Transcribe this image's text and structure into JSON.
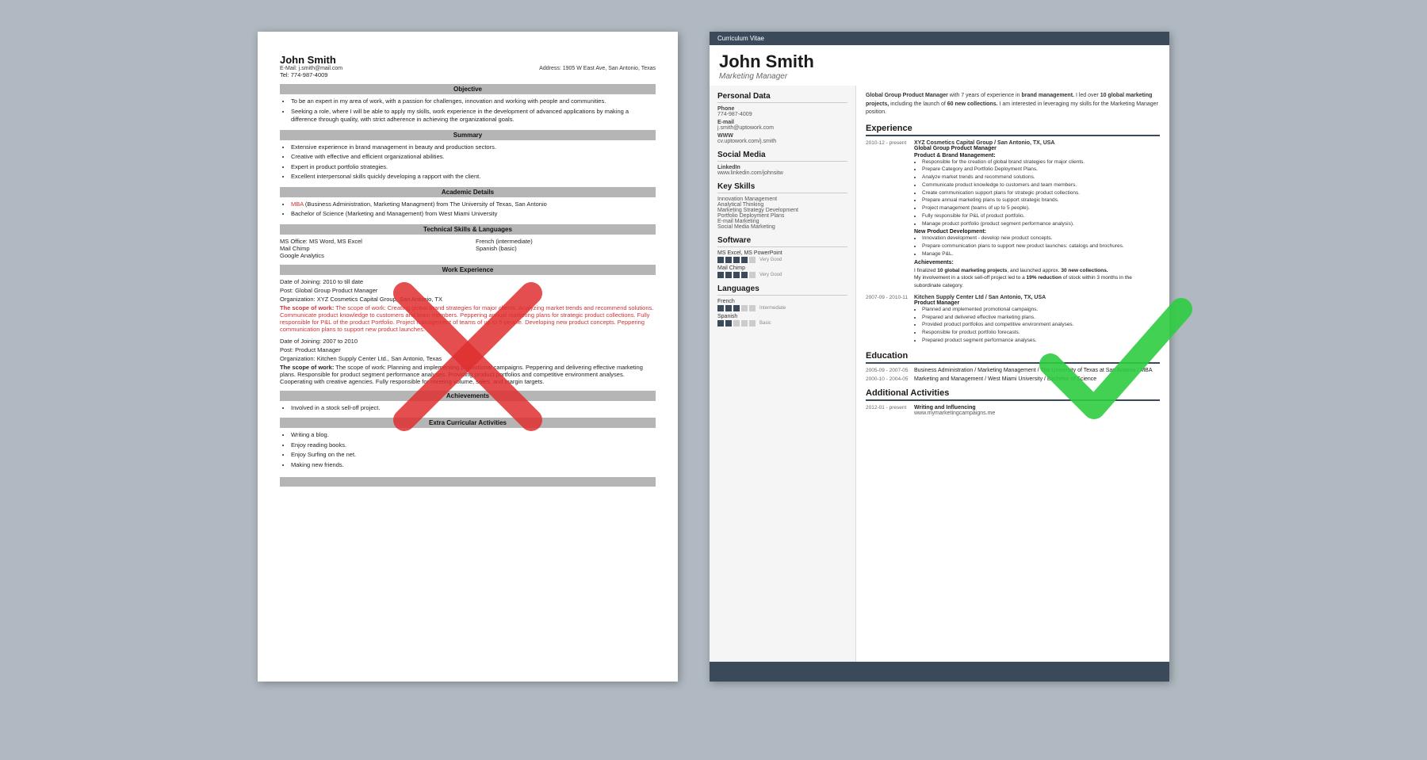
{
  "left_resume": {
    "name": "John Smith",
    "email_label": "E-Mail:",
    "email": "j.smith@mail.com",
    "address_label": "Address:",
    "address": "1905 W East Ave, San Antonio, Texas",
    "tel_label": "Tel:",
    "tel": "774-987-4009",
    "sections": {
      "objective": {
        "header": "Objective",
        "bullets": [
          "To be an expert in my area of work, with a passion for challenges, innovation and working with people and communities.",
          "Seeking a role, where I will be able to apply my skills, work experience in the development of advanced applications by making a difference through quality, with strict adherence in achieving the organizational goals."
        ]
      },
      "summary": {
        "header": "Summary",
        "bullets": [
          "Extensive experience in brand management in beauty and production sectors.",
          "Creative with effective and efficient organizational abilities.",
          "Expert in product portfolio strategies.",
          "Excellent interpersonal skills quickly developing a rapport with the client."
        ]
      },
      "academic": {
        "header": "Academic Details",
        "bullets": [
          "MBA (Business Administration, Marketing Managment) from The University of Texas, San Antonio",
          "Bachelor of Science (Marketing and Management) from West Miami University"
        ]
      },
      "technical": {
        "header": "Technical Skills & Languages",
        "skills_left": [
          "MS Office: MS Word, MS Excel",
          "Mail Chimp",
          "Google Analytics"
        ],
        "skills_right_label": [
          "French (intermediate)",
          "Spanish (basic)"
        ]
      },
      "work": {
        "header": "Work Experience",
        "entries": [
          {
            "date": "Date of Joining: 2010 to till date",
            "post": "Post: Global Group Product Manager",
            "org": "Organization: XYZ Cosmetics Capital Group, San Antonio, TX",
            "scope": "The scope of work: Creating global brand strategies for major clients. Analyzing market trends and recommend solutions. Communicate product knowledge to customers and team members. Peppering annual marketing plans for strategic product collections. Fully responsible for P&L of the product Portfolio. Project management of teams of up to 5 people. Developing new product concepts. Peppering communication plans to support new product launches."
          },
          {
            "date": "Date of Joining: 2007 to 2010",
            "post": "Post: Product Manager",
            "org": "Organization: Kitchen Supply Center Ltd., San Antonio, Texas",
            "scope": "The scope of work: Planning and implementing promotional campaigns. Peppering and delivering effective marketing plans. Responsible for product segment performance analyses. Providing product portfolios and competitive environment analyses. Cooperating with creative agencies. Fully responsible for meeting volume, sales, and margin targets."
          }
        ]
      },
      "achievements": {
        "header": "Achievements",
        "bullets": [
          "Involved in a stock sell-off project."
        ]
      },
      "extra": {
        "header": "Extra Curricular Activities",
        "bullets": [
          "Writing a blog.",
          "Enjoy reading books.",
          "Enjoy Surfing on the net.",
          "Making new friends."
        ]
      }
    }
  },
  "right_resume": {
    "cv_label": "Curriculum Vitae",
    "name": "John Smith",
    "title": "Marketing Manager",
    "summary": "Global Group Product Manager with 7 years of experience in brand management. I led over 10 global marketing projects, including the launch of 60 new collections. I am interested in leveraging my skills for the Marketing Manager position.",
    "sidebar": {
      "personal_data": {
        "title": "Personal Data",
        "phone_label": "Phone",
        "phone": "774-987-4009",
        "email_label": "E-mail",
        "email": "j.smith@uptowork.com",
        "www_label": "WWW",
        "www": "cv.uptowork.com/j.smith"
      },
      "social_media": {
        "title": "Social Media",
        "linkedin_label": "LinkedIn",
        "linkedin": "www.linkedin.com/johnsitw"
      },
      "key_skills": {
        "title": "Key Skills",
        "items": [
          "Innovation Management",
          "Analytical Thinking",
          "Marketing Strategy Development",
          "Portfolio Deployment Plans",
          "E-mail Marketing",
          "Social Media Marketing"
        ]
      },
      "software": {
        "title": "Software",
        "items": [
          {
            "name": "MS Excel, MS PowerPoint",
            "level": 4,
            "max": 5,
            "label": "Very Good"
          },
          {
            "name": "Mail Chimp",
            "level": 4,
            "max": 5,
            "label": "Very Good"
          }
        ]
      },
      "languages": {
        "title": "Languages",
        "items": [
          {
            "name": "French",
            "level": 3,
            "max": 5,
            "label": "Intermediate"
          },
          {
            "name": "Spanish",
            "level": 2,
            "max": 5,
            "label": "Basic"
          }
        ]
      }
    },
    "experience": {
      "title": "Experience",
      "entries": [
        {
          "dates": "2010-12 - present",
          "org": "XYZ Cosmetics Capital Group / San Antonio, TX, USA",
          "role": "Global Group Product Manager",
          "section1": "Product & Brand Management:",
          "bullets1": [
            "Responsible for the creation of global brand strategies for major clients.",
            "Prepare Category and Portfolio Deployment Plans.",
            "Analyze market trends and recommend solutions.",
            "Communicate product knowledge to customers and team members.",
            "Create communication support plans for strategic product collections.",
            "Prepare annual marketing plans to support strategic brands.",
            "Project management (teams of up to 5 people).",
            "Fully responsible for P&L of product portfolio.",
            "Manage product portfolio (product segment performance analysis)."
          ],
          "section2": "New Product Development:",
          "bullets2": [
            "Innovation development - develop new product concepts.",
            "Prepare communication plans to support new product launches: catalogs and brochures.",
            "Manage P&L."
          ],
          "section3": "Achievements:",
          "ach_text": "I finalized 10 global marketing projects, and launched approx. 30 new collections.",
          "ach_text2": "My involvement in a stock sell-off project led to a 19% reduction of stock within 3 months in the subordinate category."
        },
        {
          "dates": "2007-09 - 2010-11",
          "org": "Kitchen Supply Center Ltd / San Antonio, TX, USA",
          "role": "Product Manager",
          "bullets": [
            "Planned and implemented promotional campaigns.",
            "Prepared and delivered effective marketing plans.",
            "Provided product portfolios and competitive environment analyses.",
            "Responsible for product portfolio forecasts.",
            "Prepared product segment performance analyses."
          ]
        }
      ]
    },
    "education": {
      "title": "Education",
      "entries": [
        {
          "dates": "2005-09 - 2007-05",
          "text": "Business Administration / Marketing Management / The University of Texas at San Antonio / MBA"
        },
        {
          "dates": "2000-10 - 2004-05",
          "text": "Marketing and Management / West Miami University / Bachelor of Science"
        }
      ]
    },
    "additional": {
      "title": "Additional Activities",
      "entries": [
        {
          "dates": "2012-01 - present",
          "title": "Writing and Influencing",
          "url": "www.mymarketingcampaigns.me"
        }
      ]
    }
  }
}
